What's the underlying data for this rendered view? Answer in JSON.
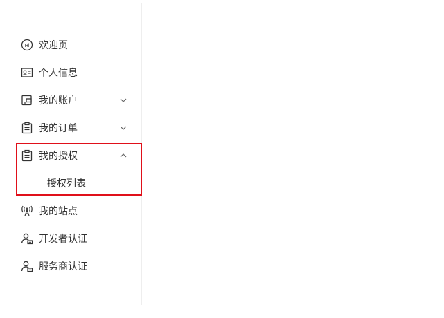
{
  "sidebar": {
    "items": [
      {
        "label": "欢迎页",
        "icon": "hi-icon"
      },
      {
        "label": "个人信息",
        "icon": "id-card-icon"
      },
      {
        "label": "我的账户",
        "icon": "wallet-icon",
        "expandable": true,
        "expanded": false
      },
      {
        "label": "我的订单",
        "icon": "clipboard-icon",
        "expandable": true,
        "expanded": false
      },
      {
        "label": "我的授权",
        "icon": "clipboard-icon",
        "expandable": true,
        "expanded": true,
        "children": [
          {
            "label": "授权列表"
          }
        ]
      },
      {
        "label": "我的站点",
        "icon": "antenna-icon"
      },
      {
        "label": "开发者认证",
        "icon": "user-card-icon"
      },
      {
        "label": "服务商认证",
        "icon": "user-card-icon"
      }
    ]
  },
  "colors": {
    "highlight_border": "#e0101a",
    "text": "#333333",
    "icon": "#333333"
  }
}
